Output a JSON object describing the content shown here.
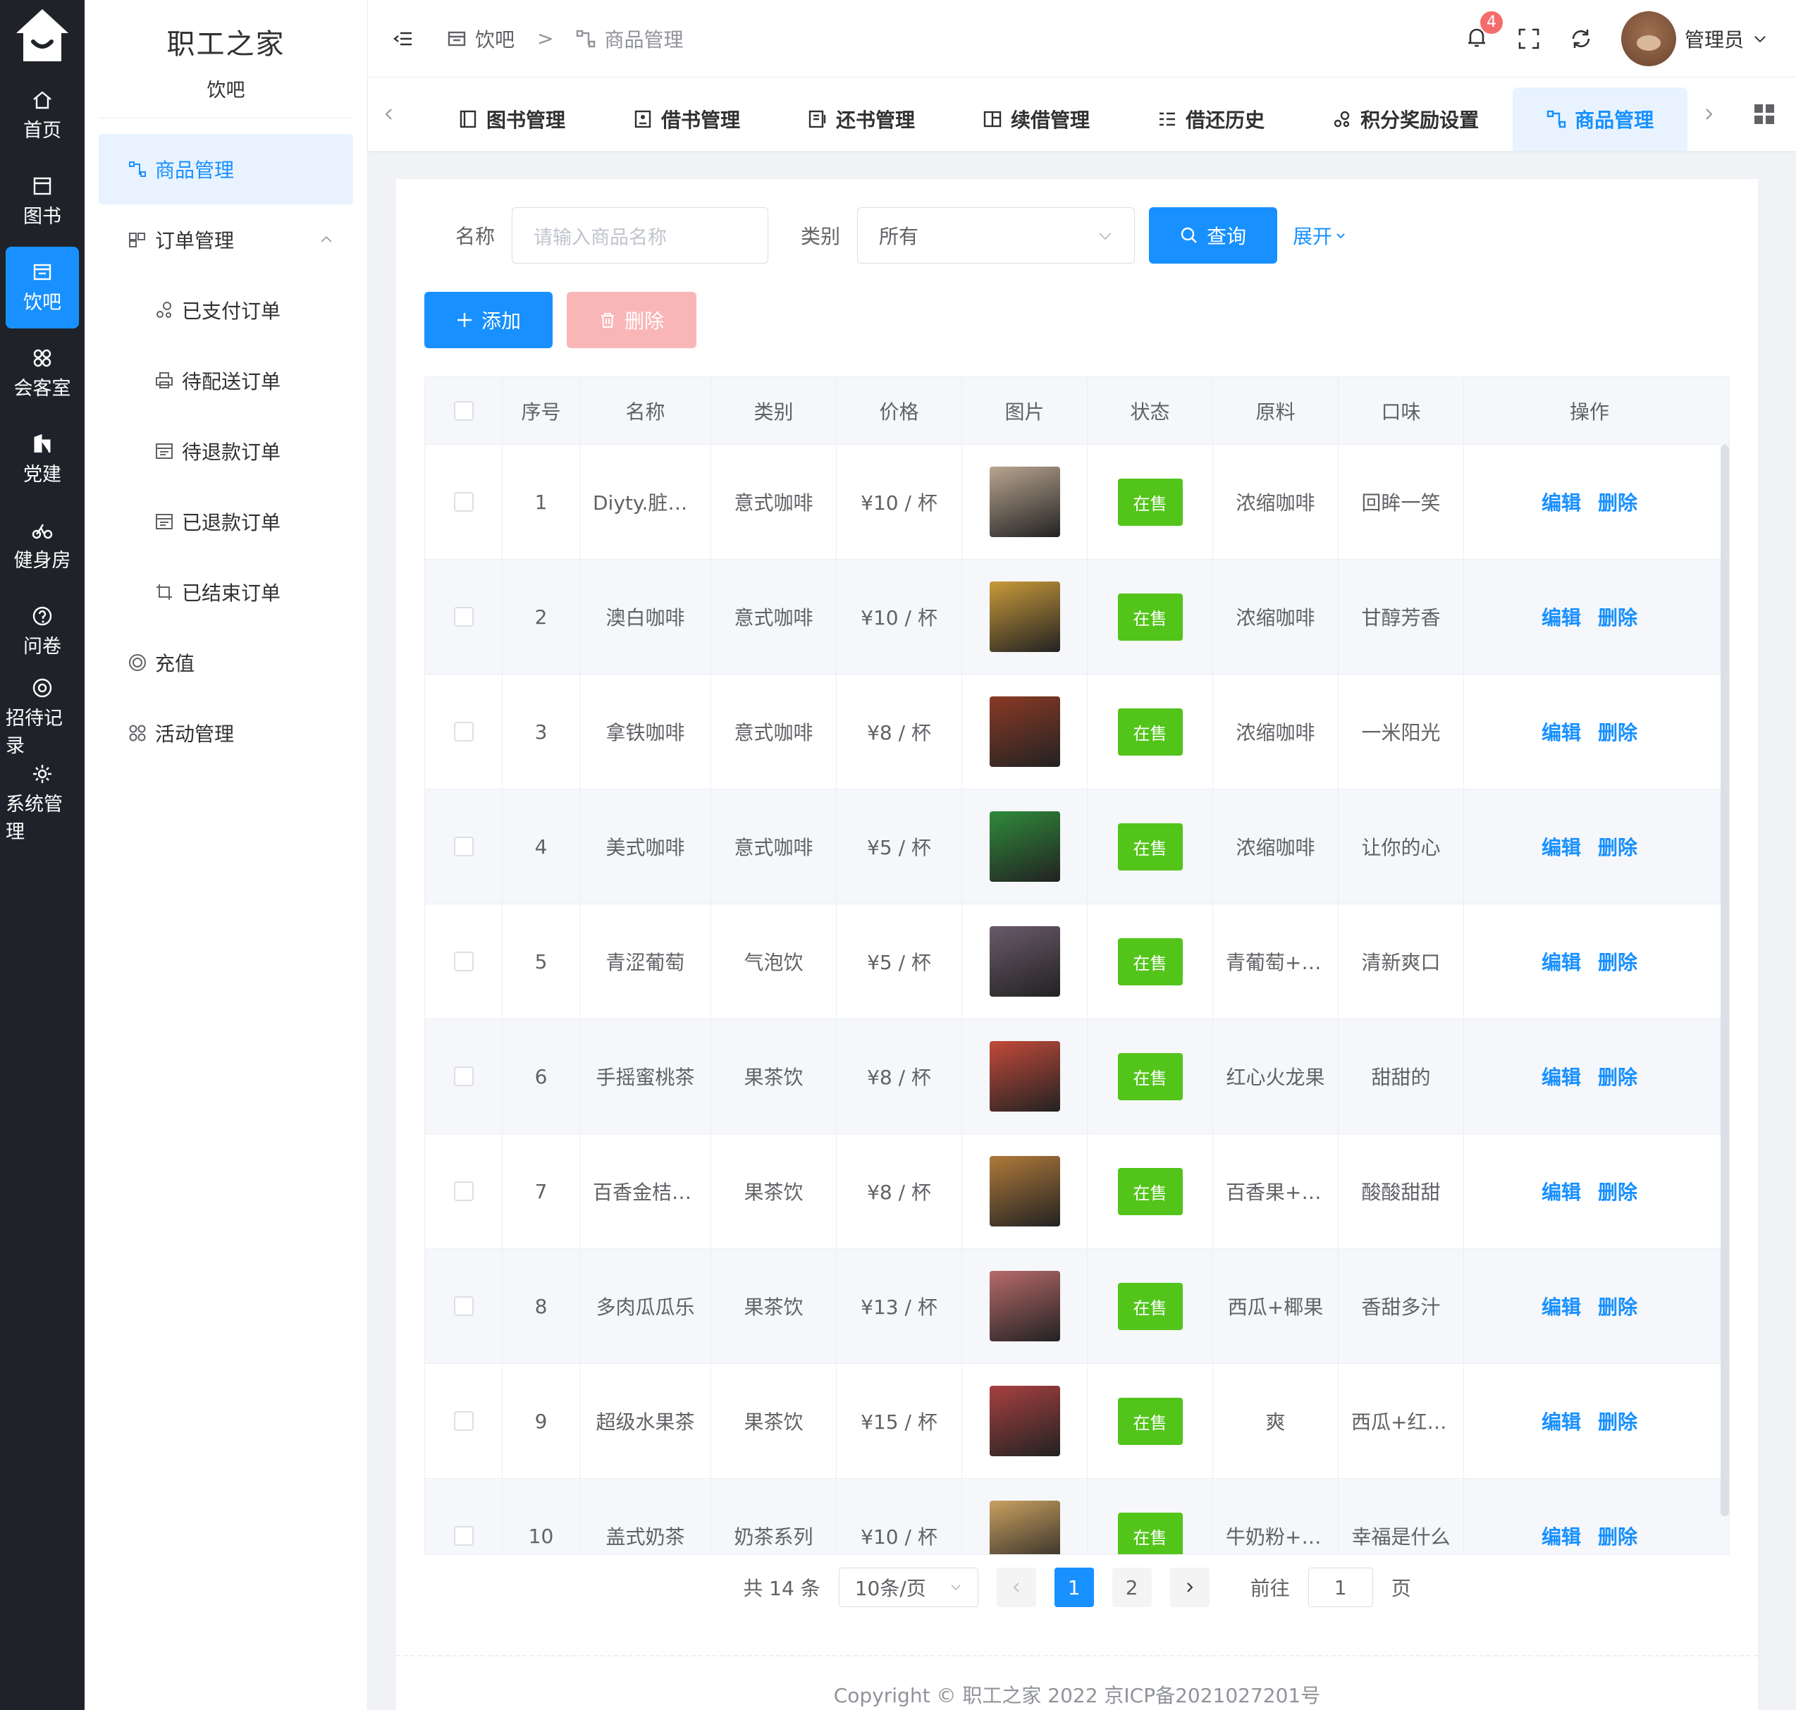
{
  "rail": {
    "items": [
      {
        "label": "首页",
        "icon": "home-icon"
      },
      {
        "label": "图书",
        "icon": "book-icon"
      },
      {
        "label": "饮吧",
        "icon": "cup-icon",
        "active": true
      },
      {
        "label": "会客室",
        "icon": "grid-icon"
      },
      {
        "label": "党建",
        "icon": "flag-icon"
      },
      {
        "label": "健身房",
        "icon": "bike-icon"
      },
      {
        "label": "问卷",
        "icon": "question-icon"
      },
      {
        "label": "招待记录",
        "icon": "target-icon"
      },
      {
        "label": "系统管理",
        "icon": "gear-icon"
      }
    ]
  },
  "sidebar": {
    "title": "职工之家",
    "subtitle": "饮吧",
    "items": [
      {
        "label": "商品管理"
      },
      {
        "label": "订单管理"
      },
      {
        "label": "已支付订单"
      },
      {
        "label": "待配送订单"
      },
      {
        "label": "待退款订单"
      },
      {
        "label": "已退款订单"
      },
      {
        "label": "已结束订单"
      },
      {
        "label": "充值"
      },
      {
        "label": "活动管理"
      }
    ]
  },
  "header": {
    "breadcrumb": [
      "饮吧",
      ">",
      "商品管理"
    ],
    "notification_count": "4",
    "username": "管理员"
  },
  "tabs": [
    "图书管理",
    "借书管理",
    "还书管理",
    "续借管理",
    "借还历史",
    "积分奖励设置",
    "商品管理"
  ],
  "filters": {
    "name_label": "名称",
    "name_placeholder": "请输入商品名称",
    "category_label": "类别",
    "category_value": "所有",
    "query_label": "查询",
    "expand_label": "展开"
  },
  "actions": {
    "add_label": "添加",
    "delete_label": "删除"
  },
  "table": {
    "headers": [
      "序号",
      "名称",
      "类别",
      "价格",
      "图片",
      "状态",
      "原料",
      "口味",
      "操作"
    ],
    "edit_label": "编辑",
    "delete_label": "删除",
    "rows": [
      {
        "no": "1",
        "name": "Diyty.脏咖啡",
        "category": "意式咖啡",
        "price": "¥10 / 杯",
        "status": "在售",
        "material": "浓缩咖啡",
        "taste": "回眸一笑",
        "img": "#b9a590"
      },
      {
        "no": "2",
        "name": "澳白咖啡",
        "category": "意式咖啡",
        "price": "¥10 / 杯",
        "status": "在售",
        "material": "浓缩咖啡",
        "taste": "甘醇芳香",
        "img": "#c99a3a"
      },
      {
        "no": "3",
        "name": "拿铁咖啡",
        "category": "意式咖啡",
        "price": "¥8 / 杯",
        "status": "在售",
        "material": "浓缩咖啡",
        "taste": "一米阳光",
        "img": "#8a3a25"
      },
      {
        "no": "4",
        "name": "美式咖啡",
        "category": "意式咖啡",
        "price": "¥5 / 杯",
        "status": "在售",
        "material": "浓缩咖啡",
        "taste": "让你的心",
        "img": "#2f8a3a"
      },
      {
        "no": "5",
        "name": "青涩葡萄",
        "category": "气泡饮",
        "price": "¥5 / 杯",
        "status": "在售",
        "material": "青葡萄+气泡水",
        "taste": "清新爽口",
        "img": "#6a5a6a"
      },
      {
        "no": "6",
        "name": "手摇蜜桃茶",
        "category": "果茶饮",
        "price": "¥8 / 杯",
        "status": "在售",
        "material": "红心火龙果",
        "taste": "甜甜的",
        "img": "#c24a3a"
      },
      {
        "no": "7",
        "name": "百香金桔柠檬",
        "category": "果茶饮",
        "price": "¥8 / 杯",
        "status": "在售",
        "material": "百香果+金桔",
        "taste": "酸酸甜甜",
        "img": "#b07a3a"
      },
      {
        "no": "8",
        "name": "多肉瓜瓜乐",
        "category": "果茶饮",
        "price": "¥13 / 杯",
        "status": "在售",
        "material": "西瓜+椰果",
        "taste": "香甜多汁",
        "img": "#b86a6a"
      },
      {
        "no": "9",
        "name": "超级水果茶",
        "category": "果茶饮",
        "price": "¥15 / 杯",
        "status": "在售",
        "material": "爽",
        "taste": "西瓜+红心火龙果",
        "img": "#a84040"
      },
      {
        "no": "10",
        "name": "盖式奶茶",
        "category": "奶茶系列",
        "price": "¥10 / 杯",
        "status": "在售",
        "material": "牛奶粉+红茶",
        "taste": "幸福是什么",
        "img": "#c9a060"
      }
    ]
  },
  "pagination": {
    "total": "共 14 条",
    "page_size": "10条/页",
    "pages": [
      "1",
      "2"
    ],
    "goto_label": "前往",
    "goto_value": "1",
    "page_unit": "页"
  },
  "footer": {
    "text": "Copyright © 职工之家 2022 京ICP备2021027201号"
  },
  "colors": {
    "primary": "#1890ff",
    "success": "#52c41a",
    "rail_bg": "#1f2329"
  }
}
